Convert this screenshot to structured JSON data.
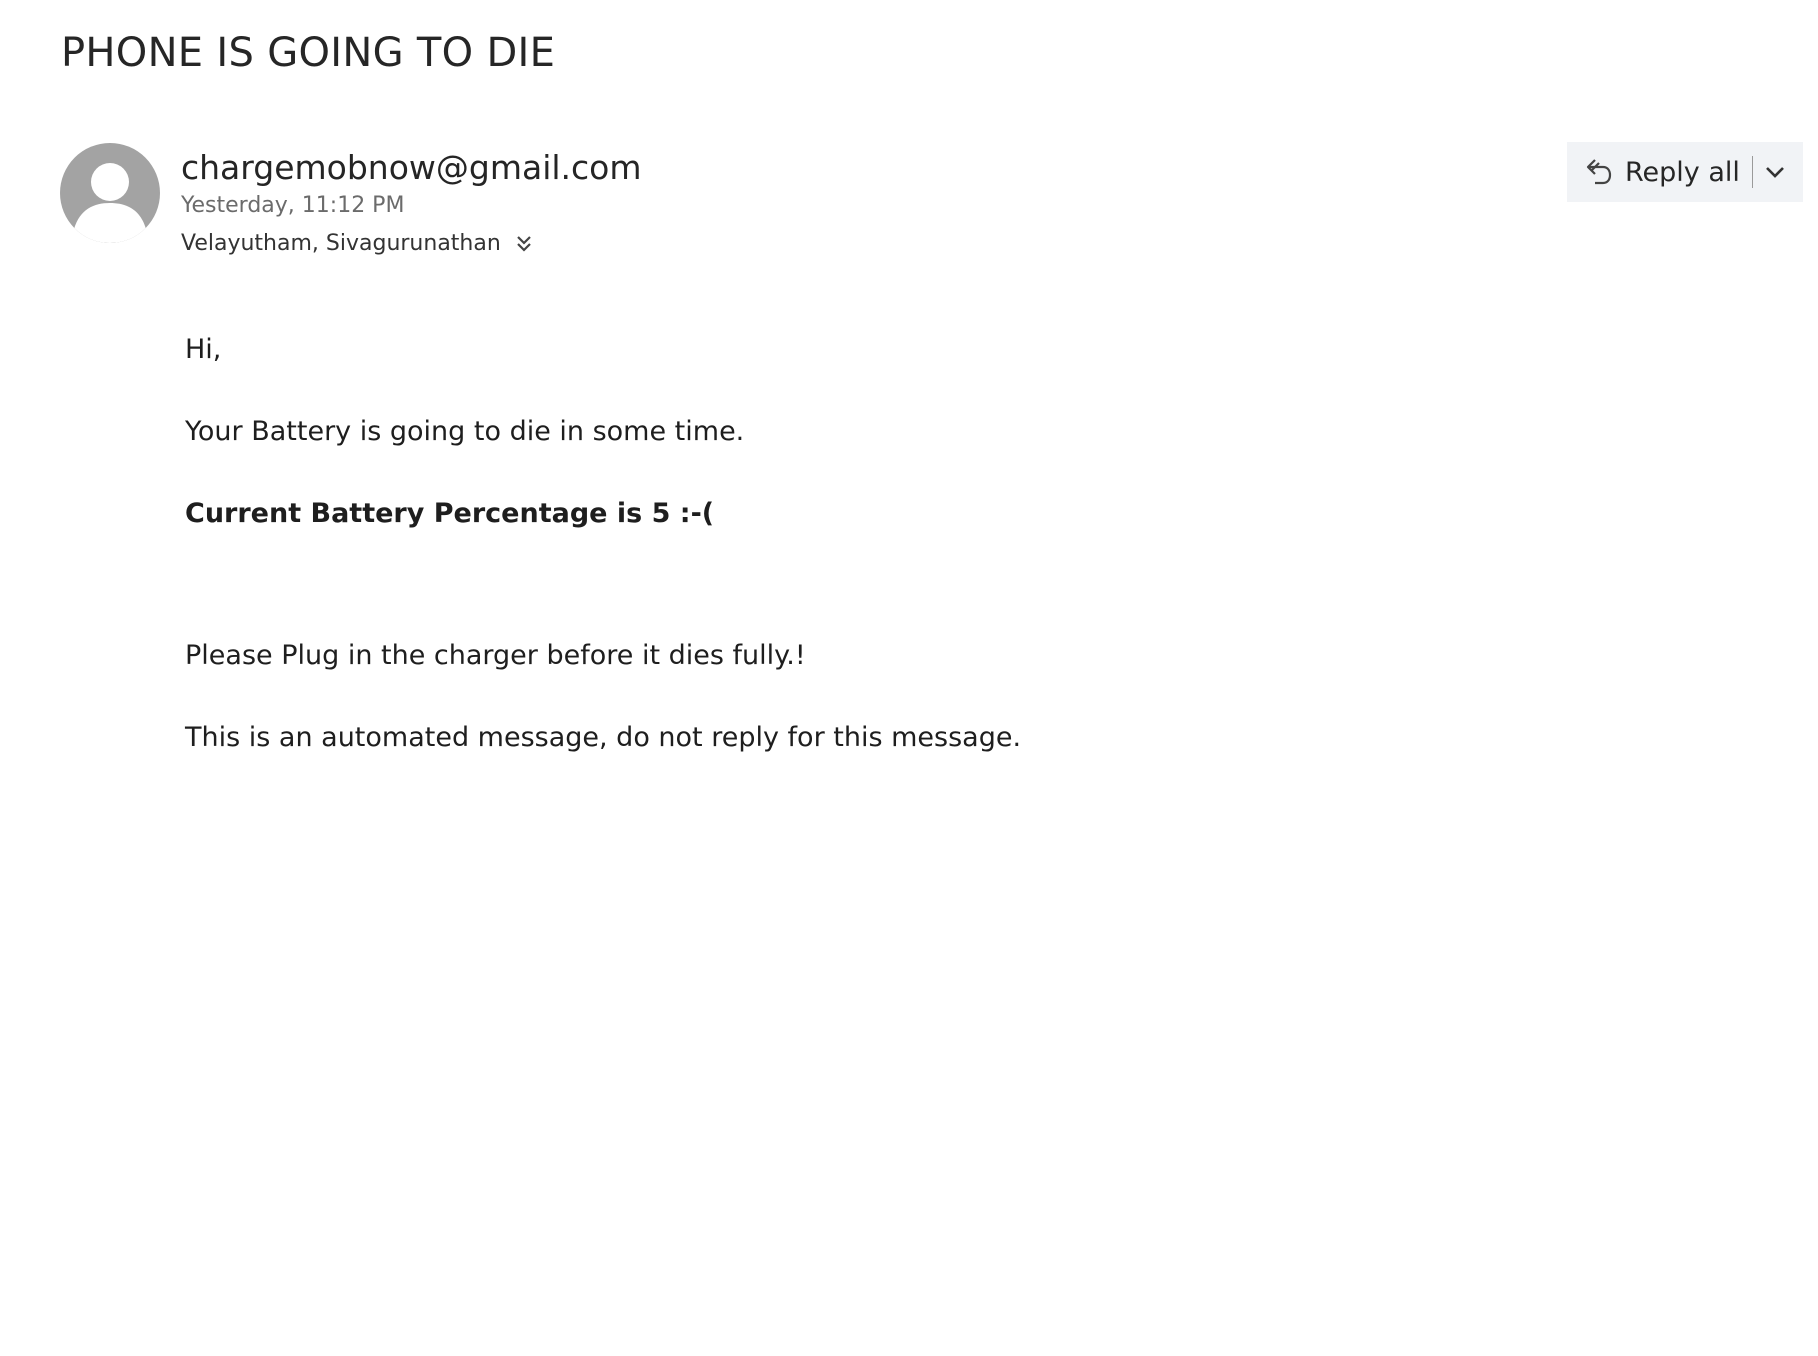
{
  "email": {
    "subject": "PHONE IS GOING TO DIE",
    "sender": "chargemobnow@gmail.com",
    "sent_time": "Yesterday, 11:12 PM",
    "recipients": "Velayutham, Sivagurunathan",
    "actions": {
      "reply_all_label": "Reply all"
    },
    "body": {
      "greeting": "Hi,",
      "line1": "Your Battery is going to die in some time.",
      "battery_line": "Current Battery Percentage is 5 :-(",
      "line2": "Please Plug in the charger before it dies fully.!",
      "line3": "This is an automated message, do not reply for this message."
    }
  },
  "colors": {
    "avatar_bg": "#a3a3a3",
    "reply_bg": "#f1f3f6",
    "secondary_text": "#6b6b6b"
  },
  "icons": {
    "avatar": "person-icon",
    "reply_all": "reply-all-icon",
    "dropdown": "chevron-down-icon",
    "expand_recipients": "double-chevron-down-icon"
  }
}
